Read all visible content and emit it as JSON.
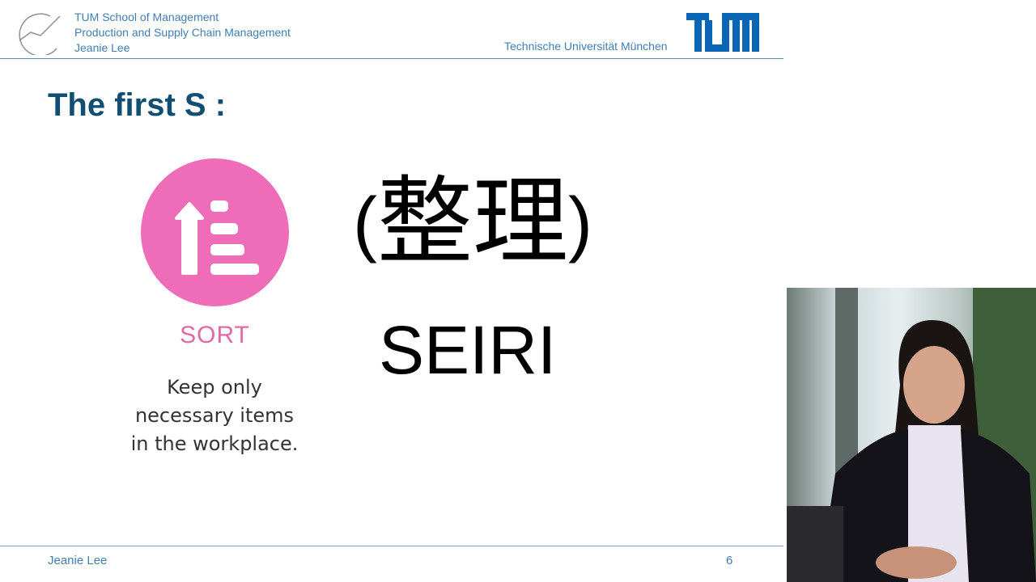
{
  "header": {
    "lines": [
      "TUM School of Management",
      "Production and Supply Chain Management",
      "Jeanie Lee"
    ],
    "university": "Technische Universität München",
    "logo_text": "TUM"
  },
  "slide": {
    "title": "The first S :",
    "icon": "sort-ascending-icon",
    "icon_color": "#ef6cb8",
    "icon_label": "SORT",
    "description": [
      "Keep only",
      "necessary items",
      "in the workplace."
    ],
    "kanji_open": "(",
    "kanji": "整理",
    "kanji_close": ")",
    "romaji": "SEIRI"
  },
  "footer": {
    "author": "Jeanie Lee",
    "page": "6"
  },
  "colors": {
    "title": "#114e74",
    "header_text": "#3f7eb0"
  }
}
